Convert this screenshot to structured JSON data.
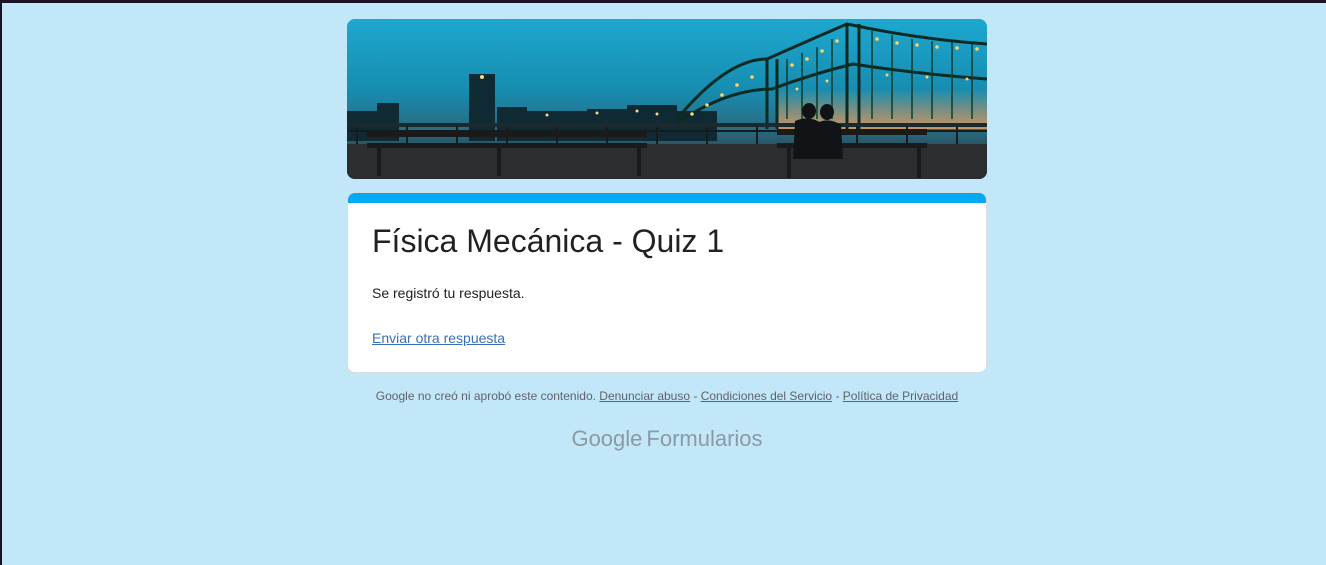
{
  "form": {
    "title": "Física Mecánica - Quiz 1",
    "confirmation_message": "Se registró tu respuesta.",
    "another_response_link": "Enviar otra respuesta"
  },
  "footer": {
    "disclaimer": "Google no creó ni aprobó este contenido.",
    "separator": " - ",
    "report_abuse": "Denunciar abuso",
    "terms": "Condiciones del Servicio",
    "privacy": "Política de Privacidad"
  },
  "brand": {
    "google": "Google",
    "product": "Formularios"
  },
  "colors": {
    "page_background": "#c2e7f9",
    "accent": "#03a9f4",
    "link": "#3b6fb6"
  }
}
